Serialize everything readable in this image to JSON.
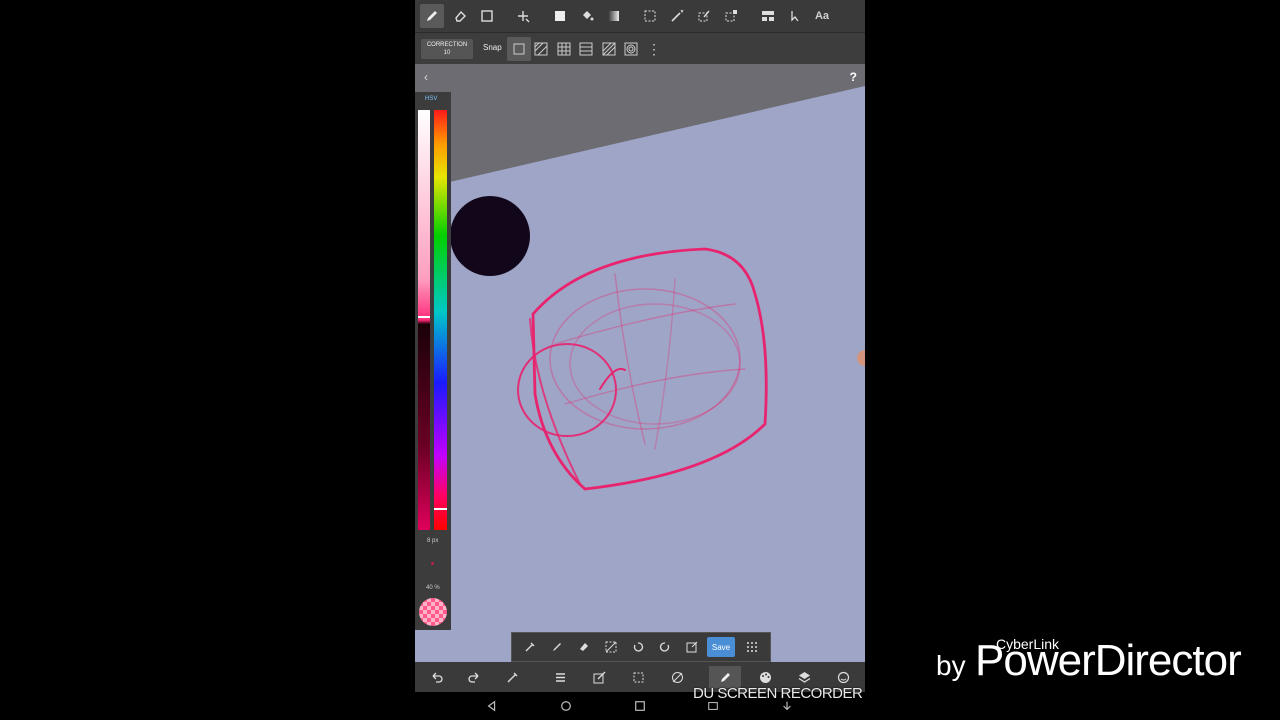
{
  "top_toolbar": {
    "tools": [
      {
        "name": "pen-icon",
        "active": true
      },
      {
        "name": "eraser-icon"
      },
      {
        "name": "rectangle-icon"
      },
      {
        "name": "move-icon"
      },
      {
        "name": "fill-rect-icon"
      },
      {
        "name": "bucket-icon"
      },
      {
        "name": "gradient-icon"
      },
      {
        "name": "select-icon"
      },
      {
        "name": "magic-wand-icon"
      },
      {
        "name": "select-pen-icon"
      },
      {
        "name": "select-eraser-icon"
      },
      {
        "name": "layer-move-icon"
      },
      {
        "name": "pointer-icon"
      }
    ],
    "text_tool_label": "Aa"
  },
  "snap_toolbar": {
    "correction_label": "CORRECTION",
    "correction_value": "10",
    "snap_label": "Snap",
    "snap_off_label": "off"
  },
  "canvas": {
    "back_glyph": "‹",
    "help_glyph": "?"
  },
  "palette": {
    "mode_label": "HSV",
    "brush_size": "8 px",
    "opacity": "40 %"
  },
  "float_toolbar": {
    "save_label": "Save"
  },
  "watermark": {
    "recorder": "DU SCREEN RECORDER",
    "by": "by",
    "cyberlink": "CyberLink",
    "product": "PowerDirector"
  },
  "colors": {
    "canvas_bg": "#9fa5c7",
    "stroke_pink": "#e8246e",
    "accent_blue": "#4a8fd6"
  }
}
